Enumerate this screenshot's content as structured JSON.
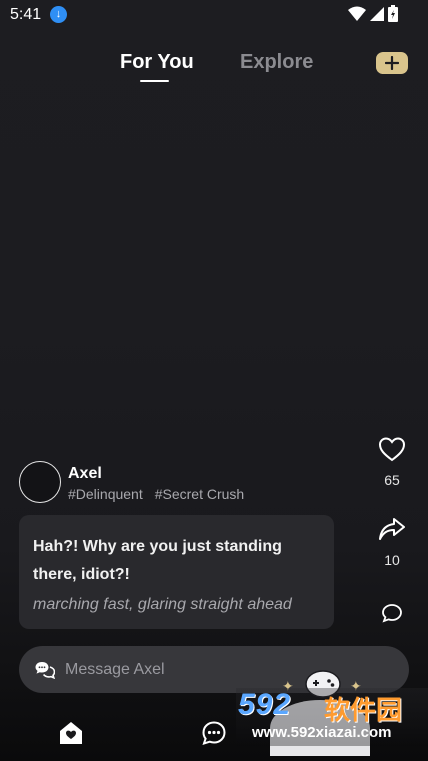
{
  "status_bar": {
    "time": "5:41"
  },
  "header": {
    "tabs": [
      {
        "label": "For You",
        "active": true
      },
      {
        "label": "Explore",
        "active": false
      }
    ],
    "add_label": "+"
  },
  "character": {
    "name": "Axel",
    "tags": [
      "#Delinquent",
      "#Secret Crush"
    ]
  },
  "message": {
    "line1": "Hah?! Why are you just standing",
    "line2": "there, idiot?!",
    "action": "marching fast, glaring straight ahead"
  },
  "actions": {
    "like_count": "65",
    "share_count": "10"
  },
  "input": {
    "placeholder": "Message Axel"
  },
  "watermark": {
    "brand": "592",
    "brand_cn": "软件园",
    "url": "www.592xiazai.com"
  },
  "colors": {
    "accent": "#d9c48c",
    "background": "#1c1c20",
    "card": "#2a2a2e",
    "download_badge": "#2f8ff5"
  },
  "icons": [
    "download-icon",
    "wifi-icon",
    "signal-icon",
    "battery-icon",
    "heart-icon",
    "share-icon",
    "comment-icon",
    "chat-bubble-icon",
    "home-heart-icon",
    "messages-icon",
    "gamepad-icon"
  ]
}
